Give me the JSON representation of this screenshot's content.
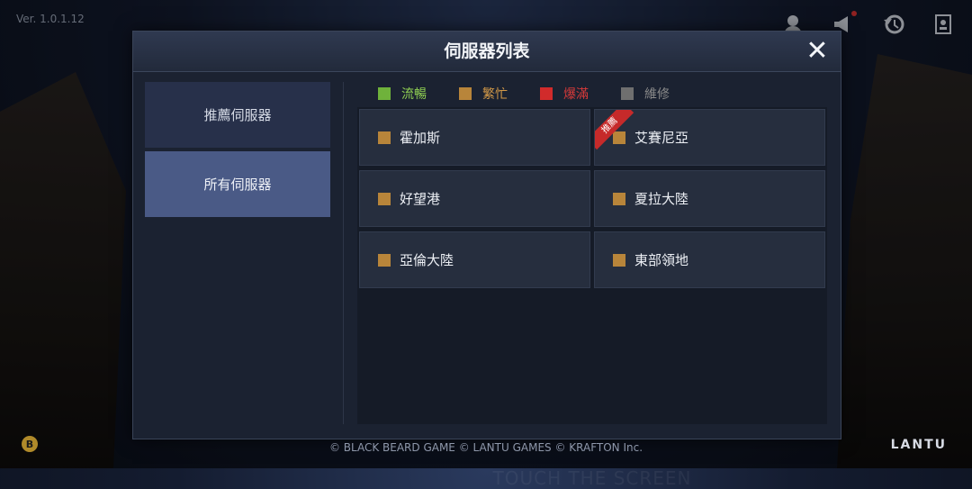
{
  "version": "Ver. 1.0.1.12",
  "top_icons": [
    "account-icon",
    "announcement-icon",
    "restore-icon",
    "profile-card-icon"
  ],
  "dialog": {
    "title": "伺服器列表",
    "close_label": "✕"
  },
  "sidebar": {
    "items": [
      {
        "label": "推薦伺服器",
        "active": false
      },
      {
        "label": "所有伺服器",
        "active": true
      }
    ]
  },
  "legend": [
    {
      "label": "流暢",
      "color": "#6fb23b",
      "text_color": "#8fcf52"
    },
    {
      "label": "繁忙",
      "color": "#b8853a",
      "text_color": "#d49a48"
    },
    {
      "label": "爆滿",
      "color": "#d12b2b",
      "text_color": "#d63a3a"
    },
    {
      "label": "維修",
      "color": "#6f6f6f",
      "text_color": "#8a8a8a"
    }
  ],
  "servers": [
    {
      "name": "霍加斯",
      "status_color": "#b8853a",
      "badge": ""
    },
    {
      "name": "艾賽尼亞",
      "status_color": "#b8853a",
      "badge": "推薦"
    },
    {
      "name": "好望港",
      "status_color": "#b8853a",
      "badge": ""
    },
    {
      "name": "夏拉大陸",
      "status_color": "#b8853a",
      "badge": ""
    },
    {
      "name": "亞倫大陸",
      "status_color": "#b8853a",
      "badge": ""
    },
    {
      "name": "東部領地",
      "status_color": "#b8853a",
      "badge": ""
    }
  ],
  "background_text": "TOUCH THE SCREEN",
  "footer": "© BLACK BEARD GAME © LANTU GAMES © KRAFTON Inc.",
  "bottom_left_badge": "B",
  "logo": "LANTU"
}
